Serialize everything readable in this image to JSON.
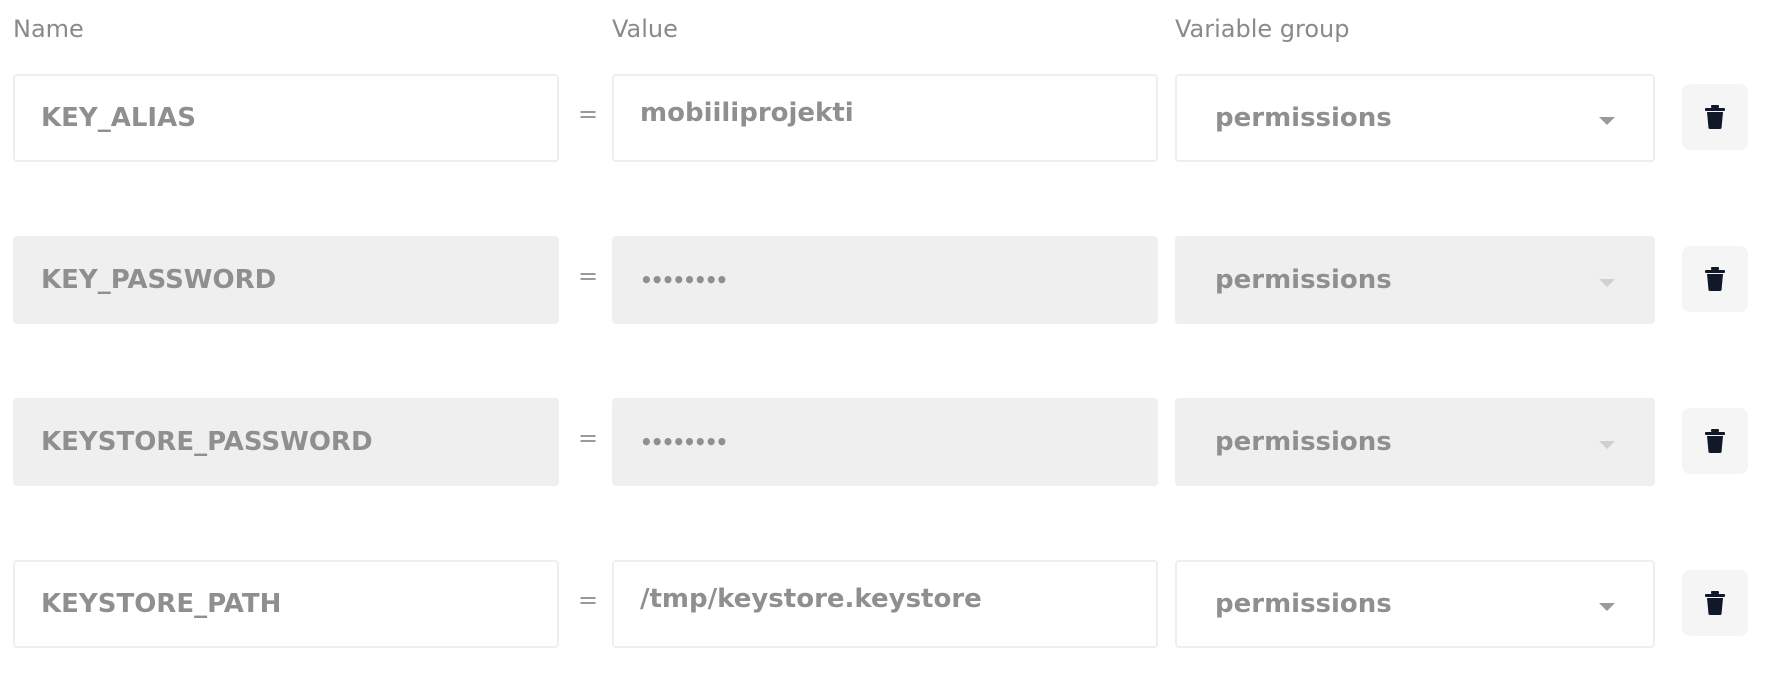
{
  "headers": {
    "name": "Name",
    "value": "Value",
    "group": "Variable group"
  },
  "equals_sign": "=",
  "rows": [
    {
      "name": "KEY_ALIAS",
      "value": "mobiiliprojekti",
      "group": "permissions",
      "editable": true,
      "masked": false
    },
    {
      "name": "KEY_PASSWORD",
      "value": "••••••••",
      "group": "permissions",
      "editable": false,
      "masked": true
    },
    {
      "name": "KEYSTORE_PASSWORD",
      "value": "••••••••",
      "group": "permissions",
      "editable": false,
      "masked": true
    },
    {
      "name": "KEYSTORE_PATH",
      "value": "/tmp/keystore.keystore",
      "group": "permissions",
      "editable": true,
      "masked": false
    }
  ],
  "icons": {
    "delete": "trash-icon",
    "dropdown": "chevron-down-icon"
  },
  "colors": {
    "text": "#8f8f8f",
    "locked_background": "#efefef",
    "icon": "#111827"
  }
}
